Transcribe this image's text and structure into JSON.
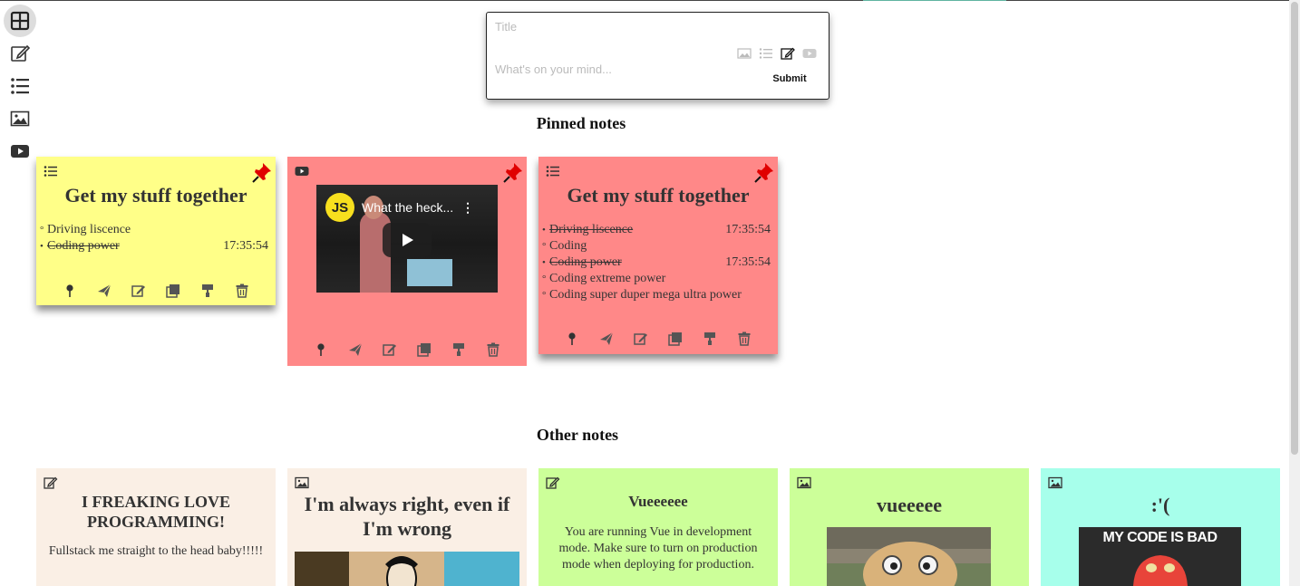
{
  "composer": {
    "title_placeholder": "Title",
    "body_placeholder": "What's on your mind...",
    "submit_label": "Submit"
  },
  "sections": {
    "pinned": "Pinned notes",
    "other": "Other notes"
  },
  "colors": {
    "yellow": "#ffff88",
    "red": "#ff8888",
    "cream": "#faefe5",
    "green": "#ccff99",
    "cyan": "#a7ffeb",
    "pin_red": "#e00000"
  },
  "pinned_notes": [
    {
      "type": "list-icon",
      "title": "Get my stuff together",
      "items": [
        {
          "text": "Driving liscence",
          "done": false,
          "time": ""
        },
        {
          "text": "Coding power",
          "done": true,
          "time": "17:35:54"
        }
      ]
    },
    {
      "type": "video-icon",
      "video_title": "What the heck...",
      "video_badge": "JS"
    },
    {
      "type": "list-icon",
      "title": "Get my stuff together",
      "items": [
        {
          "text": "Driving liscence",
          "done": true,
          "time": "17:35:54"
        },
        {
          "text": "Coding",
          "done": false,
          "time": ""
        },
        {
          "text": "Coding power",
          "done": true,
          "time": "17:35:54"
        },
        {
          "text": "Coding extreme power",
          "done": false,
          "time": ""
        },
        {
          "text": "Coding super duper mega ultra power",
          "done": false,
          "time": ""
        }
      ]
    }
  ],
  "other_notes": [
    {
      "type": "edit-icon",
      "title": "I FREAKING LOVE PROGRAMMING!",
      "body": "Fullstack me straight to the head baby!!!!!"
    },
    {
      "type": "image-icon",
      "title": "I'm always right, even if I'm wrong"
    },
    {
      "type": "edit-icon",
      "title": "Vueeeeee",
      "body": "You are running Vue in development mode. Make sure to turn on production mode when deploying for production."
    },
    {
      "type": "image-icon",
      "title": "vueeeee"
    },
    {
      "type": "image-icon",
      "title": ":'(",
      "image_text": "MY CODE IS BAD"
    }
  ]
}
